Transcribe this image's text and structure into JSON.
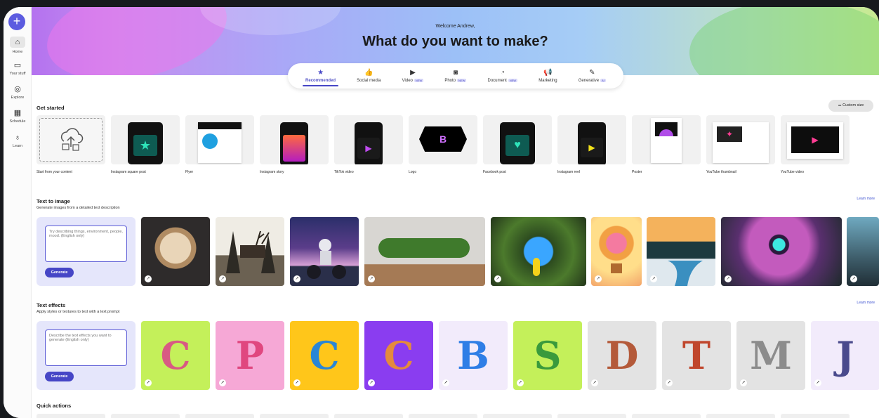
{
  "rail": {
    "fab_symbol": "+",
    "items": [
      {
        "label": "Home",
        "icon": "home-icon",
        "glyph": "⌂"
      },
      {
        "label": "Your stuff",
        "icon": "folder-icon",
        "glyph": "▭"
      },
      {
        "label": "Explore",
        "icon": "compass-icon",
        "glyph": "◎"
      },
      {
        "label": "Schedule",
        "icon": "calendar-icon",
        "glyph": "▦"
      },
      {
        "label": "Learn",
        "icon": "lightbulb-icon",
        "glyph": "♁"
      }
    ]
  },
  "hero": {
    "welcome": "Welcome Andrew,",
    "headline": "What do you want to make?"
  },
  "tabs": [
    {
      "label": "Recommended",
      "glyph": "★",
      "badge": ""
    },
    {
      "label": "Social media",
      "glyph": "👍",
      "badge": ""
    },
    {
      "label": "Video",
      "glyph": "▶",
      "badge": "NEW"
    },
    {
      "label": "Photo",
      "glyph": "◙",
      "badge": "NEW"
    },
    {
      "label": "Document",
      "glyph": "◔",
      "badge": "NEW"
    },
    {
      "label": "Marketing",
      "glyph": "📢",
      "badge": ""
    },
    {
      "label": "Generative",
      "glyph": "✎",
      "badge": "AI"
    }
  ],
  "get_started": {
    "title": "Get started",
    "custom_size": "Custom size",
    "items": [
      "Start from your content",
      "Instagram square post",
      "Flyer",
      "Instagram story",
      "TikTok video",
      "Logo",
      "Facebook post",
      "Instagram reel",
      "Poster",
      "YouTube thumbnail",
      "YouTube video"
    ]
  },
  "text_to_image": {
    "title": "Text to image",
    "subtitle": "Generate images from a detailed text description",
    "learn_more": "Learn more",
    "placeholder": "Try describing things, environment, people, mood. (English only)",
    "generate": "Generate"
  },
  "text_effects": {
    "title": "Text effects",
    "subtitle": "Apply styles or textures to text with a text prompt",
    "learn_more": "Learn more",
    "placeholder": "Describe the text effects you want to generate (English only)",
    "generate": "Generate",
    "letters": [
      "C",
      "P",
      "C",
      "C",
      "B",
      "S",
      "D",
      "T",
      "M",
      "J"
    ]
  },
  "quick_actions": {
    "title": "Quick actions"
  },
  "colors": {
    "accent": "#4646c6",
    "rail_fab": "#5c5ce0"
  }
}
